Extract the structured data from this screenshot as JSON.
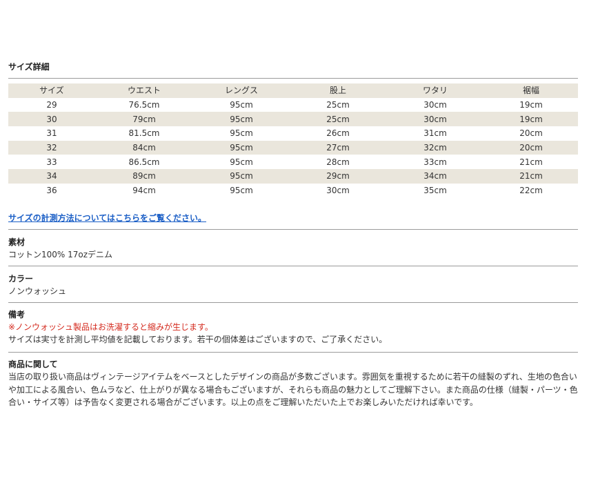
{
  "size_detail": {
    "title": "サイズ詳細",
    "columns": [
      "サイズ",
      "ウエスト",
      "レングス",
      "股上",
      "ワタリ",
      "裾幅"
    ],
    "rows": [
      [
        "29",
        "76.5cm",
        "95cm",
        "25cm",
        "30cm",
        "19cm"
      ],
      [
        "30",
        "79cm",
        "95cm",
        "25cm",
        "30cm",
        "19cm"
      ],
      [
        "31",
        "81.5cm",
        "95cm",
        "26cm",
        "31cm",
        "20cm"
      ],
      [
        "32",
        "84cm",
        "95cm",
        "27cm",
        "32cm",
        "20cm"
      ],
      [
        "33",
        "86.5cm",
        "95cm",
        "28cm",
        "33cm",
        "21cm"
      ],
      [
        "34",
        "89cm",
        "95cm",
        "29cm",
        "34cm",
        "21cm"
      ],
      [
        "36",
        "94cm",
        "95cm",
        "30cm",
        "35cm",
        "22cm"
      ]
    ],
    "shade_color": "#eae6dc"
  },
  "measure_link": "サイズの計測方法についてはこちらをご覧ください。",
  "material": {
    "title": "素材",
    "value": "コットン100% 17ozデニム"
  },
  "color": {
    "title": "カラー",
    "value": "ノンウォッシュ"
  },
  "remarks": {
    "title": "備考",
    "warning": "※ノンウォッシュ製品はお洗濯すると縮みが生じます。",
    "note": "サイズは実寸を計測し平均値を記載しております。若干の個体差はございますので、ご了承ください。"
  },
  "about": {
    "title": "商品に関して",
    "text": "当店の取り扱い商品はヴィンテージアイテムをベースとしたデザインの商品が多数ございます。雰囲気を重視するために若干の縫製のずれ、生地の色合いや加工による風合い、色ムラなど、仕上がりが異なる場合もございますが、それらも商品の魅力としてご理解下さい。また商品の仕様（縫製・パーツ・色合い・サイズ等）は予告なく変更される場合がございます。以上の点をご理解いただいた上でお楽しみいただければ幸いです。"
  },
  "colors": {
    "link": "#1a5ec6",
    "warning": "#d42a1e",
    "rule": "#9a9a9a"
  }
}
